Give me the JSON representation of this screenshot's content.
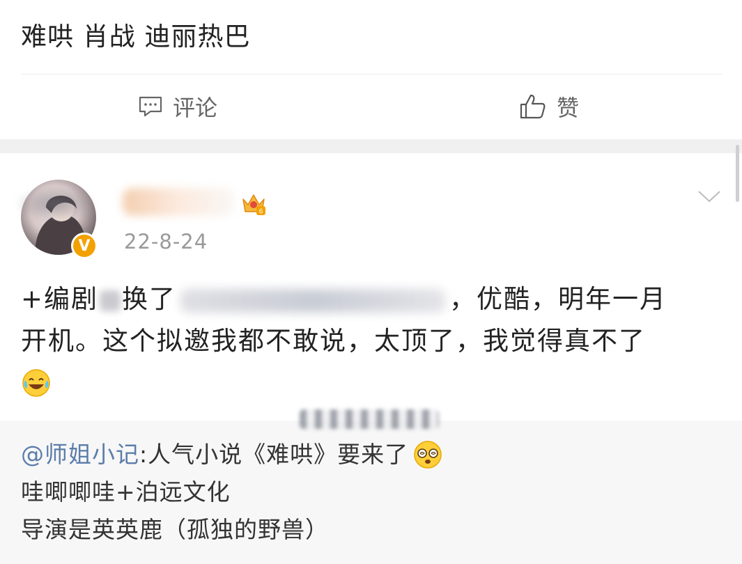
{
  "top_post": {
    "text": "难哄 肖战 迪丽热巴"
  },
  "actions": {
    "comment_label": "评论",
    "like_label": "赞"
  },
  "post": {
    "date": "22-8-24",
    "vip_badge": "V",
    "crown_level": "6",
    "line1_prefix": "+编剧",
    "line1_mid": "换了",
    "line1_suffix": "，优酷，明年一月",
    "line2": "开机。这个拟邀我都不敢说，太顶了，我觉得真不了",
    "emoji": "laughing-crying-emoji"
  },
  "quote": {
    "mention": "@师姐小记",
    "line1_text": ":人气小说《难哄》要来了",
    "line2": "哇唧唧哇+泊远文化",
    "line3": "导演是英英鹿（孤独的野兽）"
  },
  "colors": {
    "mention_link": "#5b7dab",
    "vip_badge": "#f3a100",
    "quote_background": "#f7f7f7"
  }
}
